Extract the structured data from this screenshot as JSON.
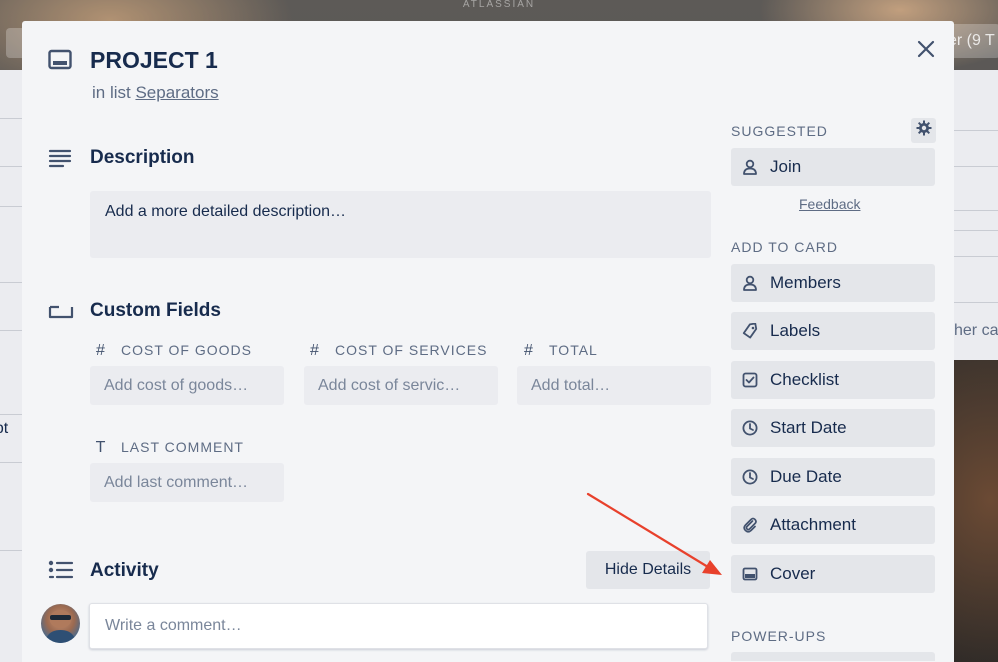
{
  "background": {
    "brand": "ATLASSIAN",
    "right_pill_text": "er (9 T",
    "left_list_text": "ript",
    "right_list_text": "her ca"
  },
  "card": {
    "title": "PROJECT 1",
    "in_list_prefix": "in list",
    "list_name": "Separators"
  },
  "description": {
    "heading": "Description",
    "placeholder": "Add a more detailed description…"
  },
  "custom_fields": {
    "heading": "Custom Fields",
    "fields": [
      {
        "icon": "#",
        "label": "COST OF GOODS",
        "placeholder": "Add cost of goods…"
      },
      {
        "icon": "#",
        "label": "COST OF SERVICES",
        "placeholder": "Add cost of servic…"
      },
      {
        "icon": "#",
        "label": "TOTAL",
        "placeholder": "Add total…"
      },
      {
        "icon": "T",
        "label": "LAST COMMENT",
        "placeholder": "Add last comment…"
      }
    ]
  },
  "activity": {
    "heading": "Activity",
    "hide_details": "Hide Details",
    "comment_placeholder": "Write a comment…"
  },
  "sidebar": {
    "suggested_heading": "SUGGESTED",
    "join": "Join",
    "feedback": "Feedback",
    "add_to_card_heading": "ADD TO CARD",
    "items": [
      {
        "icon": "person-icon",
        "label": "Members"
      },
      {
        "icon": "tag-icon",
        "label": "Labels"
      },
      {
        "icon": "checkbox-icon",
        "label": "Checklist"
      },
      {
        "icon": "clock-icon",
        "label": "Start Date"
      },
      {
        "icon": "clock-icon",
        "label": "Due Date"
      },
      {
        "icon": "paperclip-icon",
        "label": "Attachment"
      },
      {
        "icon": "card-cover-icon",
        "label": "Cover"
      }
    ],
    "power_ups_heading": "POWER-UPS"
  },
  "colors": {
    "modal_bg": "#f4f5f7",
    "button_bg": "#e4e6ea",
    "text": "#172b4d",
    "muted": "#5e6c84",
    "arrow": "#e8412c"
  }
}
